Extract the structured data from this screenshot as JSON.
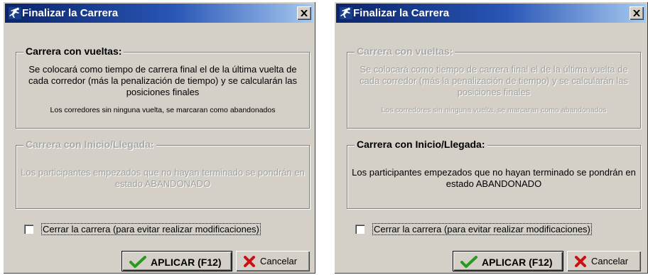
{
  "window_title": "Finalizar la Carrera",
  "close_glyph": "×",
  "lap_race": {
    "title": "Carrera con vueltas:",
    "description": "Se colocará como tiempo de carrera final el de la última vuelta de cada corredor (más la penalización de tiempo) y se calcularán las posiciones finales",
    "note": "Los corredores sin ninguna vuelta, se marcaran como abandonados"
  },
  "start_finish_race": {
    "title": "Carrera con Inicio/Llegada:",
    "description": "Los participantes empezados que no hayan terminado se pondrán en estado ABANDONADO"
  },
  "close_race_checkbox": {
    "label": "Cerrar la carrera (para evitar realizar modificaciones)",
    "checked": false
  },
  "apply_button": {
    "label": "APLICAR (F12)",
    "icon": "checkmark-icon"
  },
  "cancel_button": {
    "label": "Cancelar",
    "icon": "red-x-icon"
  },
  "colors": {
    "title_start": "#0a246a",
    "title_end": "#a6caf0",
    "dialog_bg": "#d4d0c8",
    "check_green": "#2a9a1e",
    "cancel_red": "#cc1010"
  },
  "left_dialog": {
    "active_option": "lap_race"
  },
  "right_dialog": {
    "active_option": "start_finish_race"
  }
}
